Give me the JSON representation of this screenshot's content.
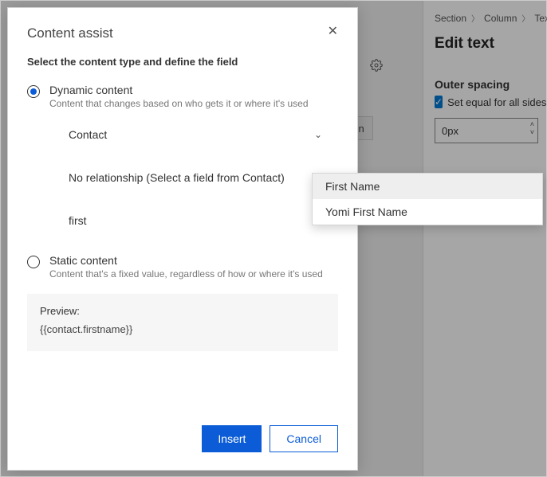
{
  "modal": {
    "title": "Content assist",
    "subtitle": "Select the content type and define the field",
    "dynamic": {
      "label": "Dynamic content",
      "desc": "Content that changes based on who gets it or where it's used",
      "entity_value": "Contact",
      "relationship_value": "No relationship (Select a field from Contact)",
      "field_value": "first"
    },
    "static": {
      "label": "Static content",
      "desc": "Content that's a fixed value, regardless of how or where it's used"
    },
    "preview_label": "Preview:",
    "preview_value": "{{contact.firstname}}",
    "insert_label": "Insert",
    "cancel_label": "Cancel"
  },
  "autocomplete": {
    "items": [
      "First Name",
      "Yomi First Name"
    ]
  },
  "side": {
    "breadcrumb": [
      "Section",
      "Column",
      "Text"
    ],
    "title": "Edit text",
    "outer_spacing_label": "Outer spacing",
    "equal_label": "Set equal for all sides",
    "spacing_value": "0px"
  },
  "bg": {
    "pill_text_suffix": "zation"
  }
}
